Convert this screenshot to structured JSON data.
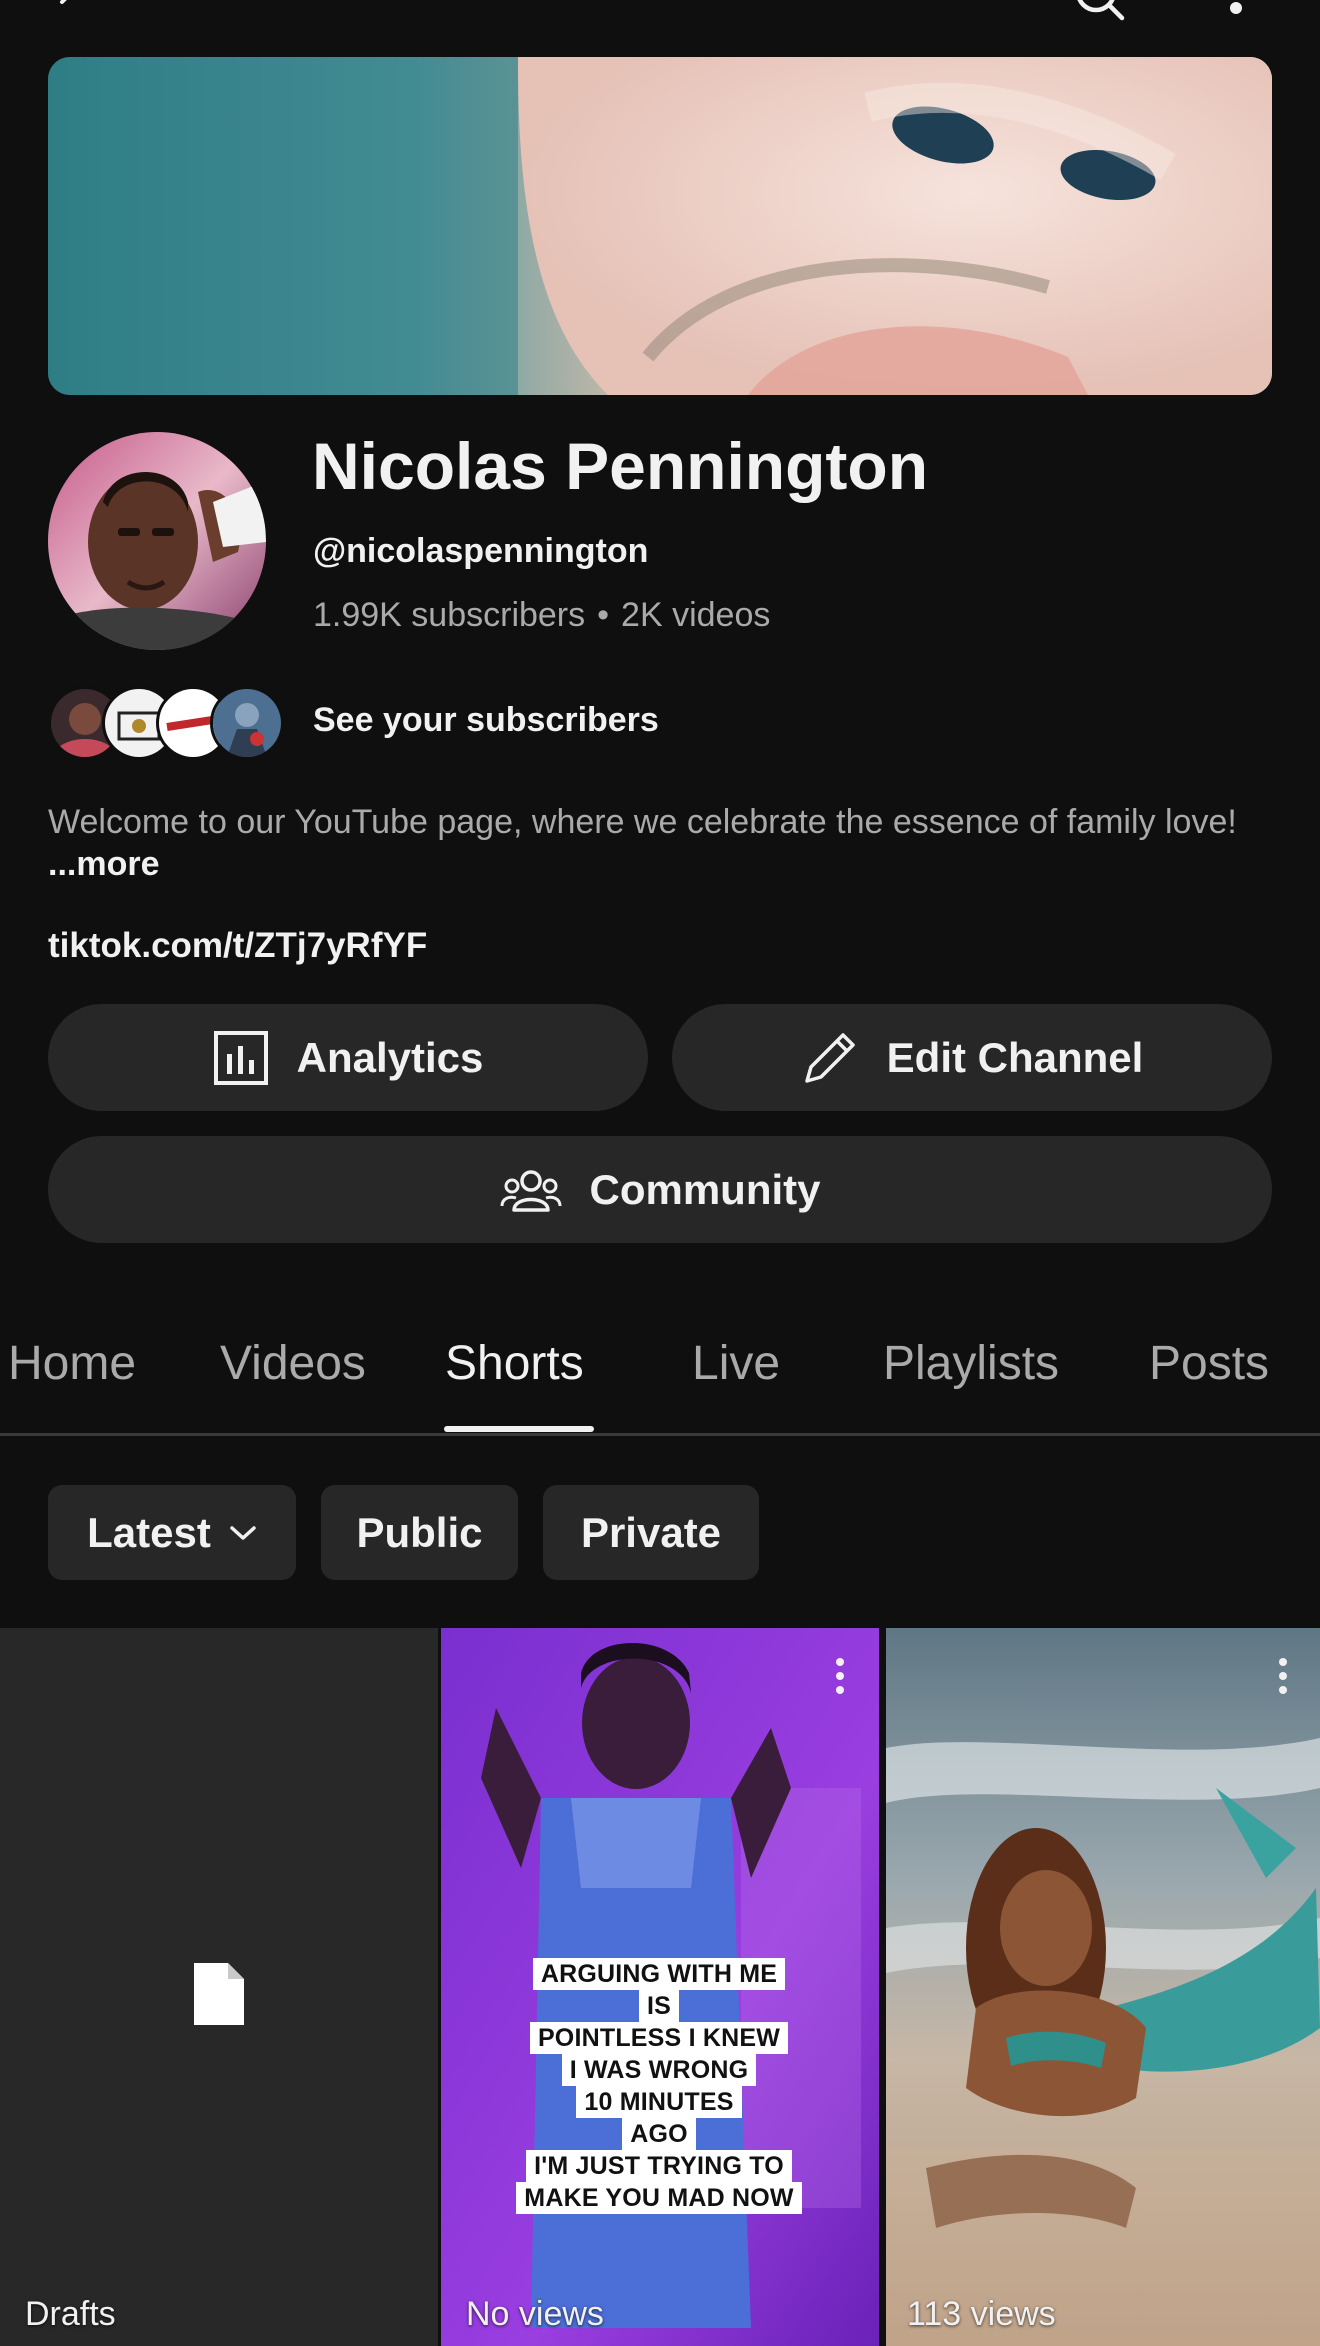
{
  "channel": {
    "name": "Nicolas Pennington",
    "handle": "@nicolaspennington",
    "subscribers": "1.99K subscribers",
    "separator": "•",
    "videos": "2K videos",
    "see_subscribers": "See your subscribers",
    "description": "Welcome to our YouTube page, where we celebrate the essence of family love!",
    "more_label": "...more",
    "link": "tiktok.com/t/ZTj7yRfYF"
  },
  "actions": {
    "analytics": "Analytics",
    "edit_channel": "Edit Channel",
    "community": "Community"
  },
  "tabs": [
    {
      "label": "Home",
      "active": false
    },
    {
      "label": "Videos",
      "active": false
    },
    {
      "label": "Shorts",
      "active": true
    },
    {
      "label": "Live",
      "active": false
    },
    {
      "label": "Playlists",
      "active": false
    },
    {
      "label": "Posts",
      "active": false
    }
  ],
  "filters": {
    "sort": "Latest",
    "public": "Public",
    "private": "Private"
  },
  "shorts": [
    {
      "label": "Drafts"
    },
    {
      "label": "No views",
      "caption": [
        "ARGUING WITH ME",
        "IS",
        "POINTLESS I KNEW",
        "I WAS WRONG",
        "10 MINUTES",
        "AGO",
        "I'M JUST TRYING TO",
        "MAKE YOU MAD NOW"
      ]
    },
    {
      "label": "113 views"
    }
  ],
  "icons": {
    "back": "back-arrow-icon",
    "search": "search-icon",
    "more": "more-vertical-icon",
    "analytics": "bar-chart-icon",
    "edit": "pencil-icon",
    "community": "people-icon",
    "sort": "chevron-down-icon",
    "draft": "document-icon"
  },
  "colors": {
    "background": "#0f0f0f",
    "surface": "#272727",
    "text_primary": "#f1f1f1",
    "text_secondary": "#aaaaaa"
  }
}
